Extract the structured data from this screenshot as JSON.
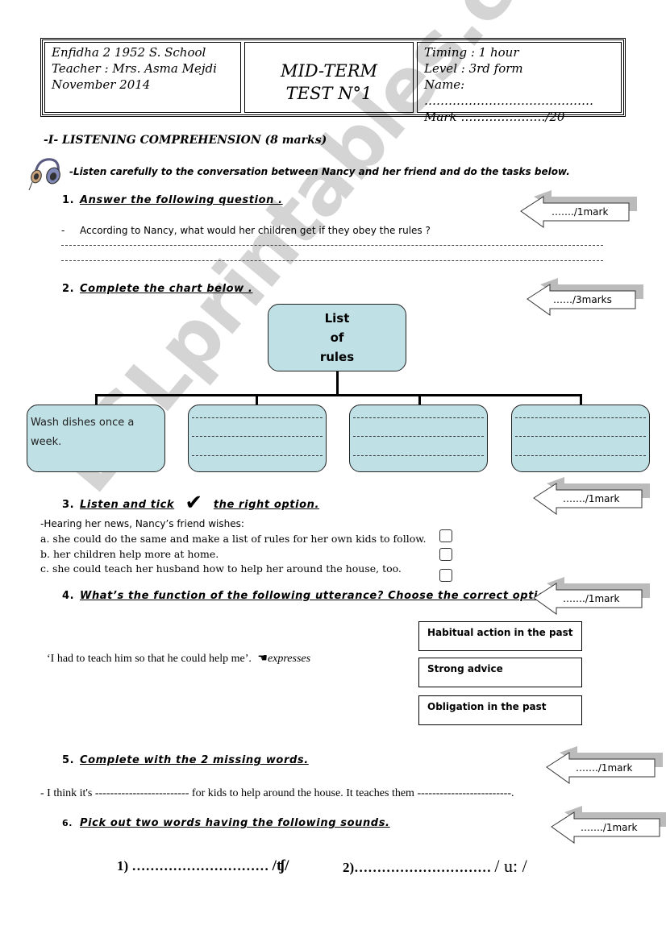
{
  "header": {
    "left": [
      "Enfidha 2 1952 S. School",
      "Teacher : Mrs.  Asma Mejdi",
      "November  2014"
    ],
    "center": [
      "MID-TERM",
      "TEST N°1"
    ],
    "right": [
      "Timing : 1 hour",
      "Level : 3rd  form",
      "Name: ……………………………………",
      "Mark …………………/20"
    ]
  },
  "section": {
    "title": "-I- LISTENING COMPREHENSION (8 marks)",
    "intro": "-Listen carefully to the conversation between Nancy and her friend and do the tasks below."
  },
  "marks": {
    "q1": "……./1mark",
    "q2": "……/3marks",
    "q3": "……./1mark",
    "q4": "……./1mark",
    "q5": "……./1mark",
    "q6": "……./1mark"
  },
  "q1": {
    "num": "1.",
    "title": "Answer the following question .",
    "question_bullet": "-",
    "question": "According to Nancy, what would her children get if they obey the rules ?"
  },
  "q2": {
    "num": "2.",
    "title": "Complete the chart below .",
    "chart_root": [
      "List",
      "of",
      "rules"
    ],
    "boxes": [
      {
        "text": "Wash dishes once a week."
      },
      {
        "text": ""
      },
      {
        "text": ""
      },
      {
        "text": ""
      }
    ]
  },
  "q3": {
    "num": "3.",
    "title_a": "Listen and tick",
    "tick_glyph": "✔",
    "title_b": "the right option.",
    "stem": "-Hearing her news, Nancy’s friend wishes:",
    "options": [
      "a. she could do the same and make a list of rules for her own kids to follow.",
      "b. her children help more at home.",
      "c. she could teach her husband how to help her around the house, too."
    ]
  },
  "q4": {
    "num": "4.",
    "title": "What’s the function of the following utterance?  Choose the correct option.",
    "utterance": "‘I had to teach him so that he could help me’.",
    "pointer_glyph": "☚",
    "expresses": "expresses",
    "options": [
      "Habitual action in the past",
      "Strong advice",
      "Obligation in the past"
    ]
  },
  "q5": {
    "num": "5.",
    "title": "Complete with the 2 missing words.",
    "sentence_a": "- I think it's ------------------------- for kids to help around the house. It teaches them -------------------------."
  },
  "q6": {
    "num": "6.",
    "title": "Pick out two words having the following sounds.",
    "item1_label": "1) …………………………",
    "item1_sound": "/ʧ/",
    "item2_label": "2)…………………………",
    "item2_sound": "/ u: /"
  },
  "watermark": "ESLprintables.com"
}
